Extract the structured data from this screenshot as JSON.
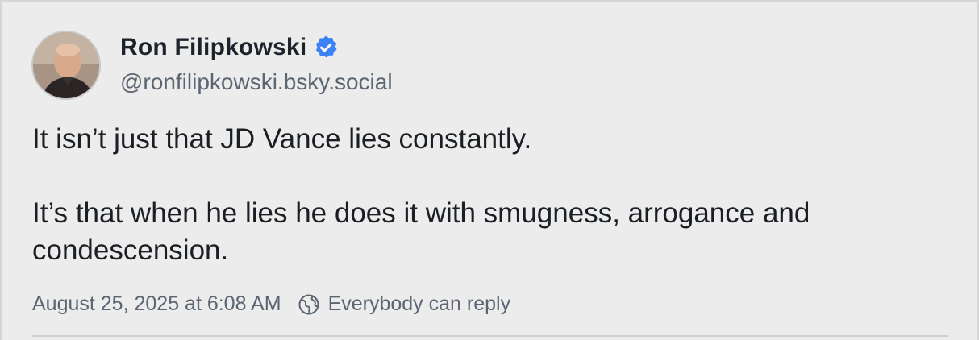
{
  "post": {
    "author_name": "Ron Filipkowski",
    "author_handle": "@ronfilipkowski.bsky.social",
    "verified_icon": "verified-badge-icon",
    "avatar_icon": "avatar",
    "text_line_1": "It isn’t just that JD Vance lies constantly.",
    "text_line_2": "It’s that when he lies he does it with smugness, arrogance and condescension.",
    "timestamp": "August 25, 2025 at 6:08 AM",
    "reply_icon": "globe-icon",
    "reply_setting": "Everybody can reply"
  },
  "colors": {
    "background": "#ececec",
    "name": "#1d232b",
    "secondary_text": "#5b6470",
    "verified_blue": "#3b82f6"
  }
}
